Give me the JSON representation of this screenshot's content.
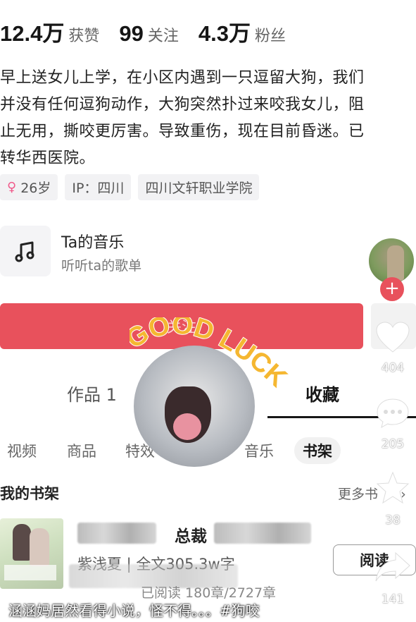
{
  "stats": {
    "likes_count": "12.4万",
    "likes_label": "获赞",
    "following_count": "99",
    "following_label": "关注",
    "followers_count": "4.3万",
    "followers_label": "粉丝"
  },
  "bio": {
    "line1": "早上送女儿上学，在小区内遇到一只逗留大狗，我们",
    "line2": "并没有任何逗狗动作，大狗突然扑过来咬我女儿，阻",
    "line3": "止无用，撕咬更厉害。导致重伤，现在目前昏迷。已",
    "line4": "转华西医院。"
  },
  "tags": {
    "age": "26岁",
    "ip": "IP：四川",
    "school": "四川文轩职业学院"
  },
  "music": {
    "title": "Ta的音乐",
    "subtitle": "听听ta的歌单"
  },
  "follow_button": {
    "label": "关注"
  },
  "tabs": {
    "works": "作品 1",
    "favorites": "收藏"
  },
  "subtabs": [
    "视频",
    "商品",
    "特效",
    "音乐",
    "书架"
  ],
  "shelf": {
    "title": "我的书架",
    "more": "更多书",
    "book_title": "总裁",
    "book_meta": "紫浅夏 | 全文305.3w字",
    "book_progress": "已阅读 180章/2727章",
    "read_label": "阅读"
  },
  "sidebar": {
    "likes": "404",
    "comments": "205",
    "favorites": "38",
    "shares": "141"
  },
  "sticker": {
    "text": "GOOD LUCK"
  },
  "caption": "涵涵妈居然看得小说，怪不得。。。#狗咬",
  "colors": {
    "accent": "#e8515c",
    "female": "#f05a8b",
    "sticker_text": "#f5b731"
  }
}
